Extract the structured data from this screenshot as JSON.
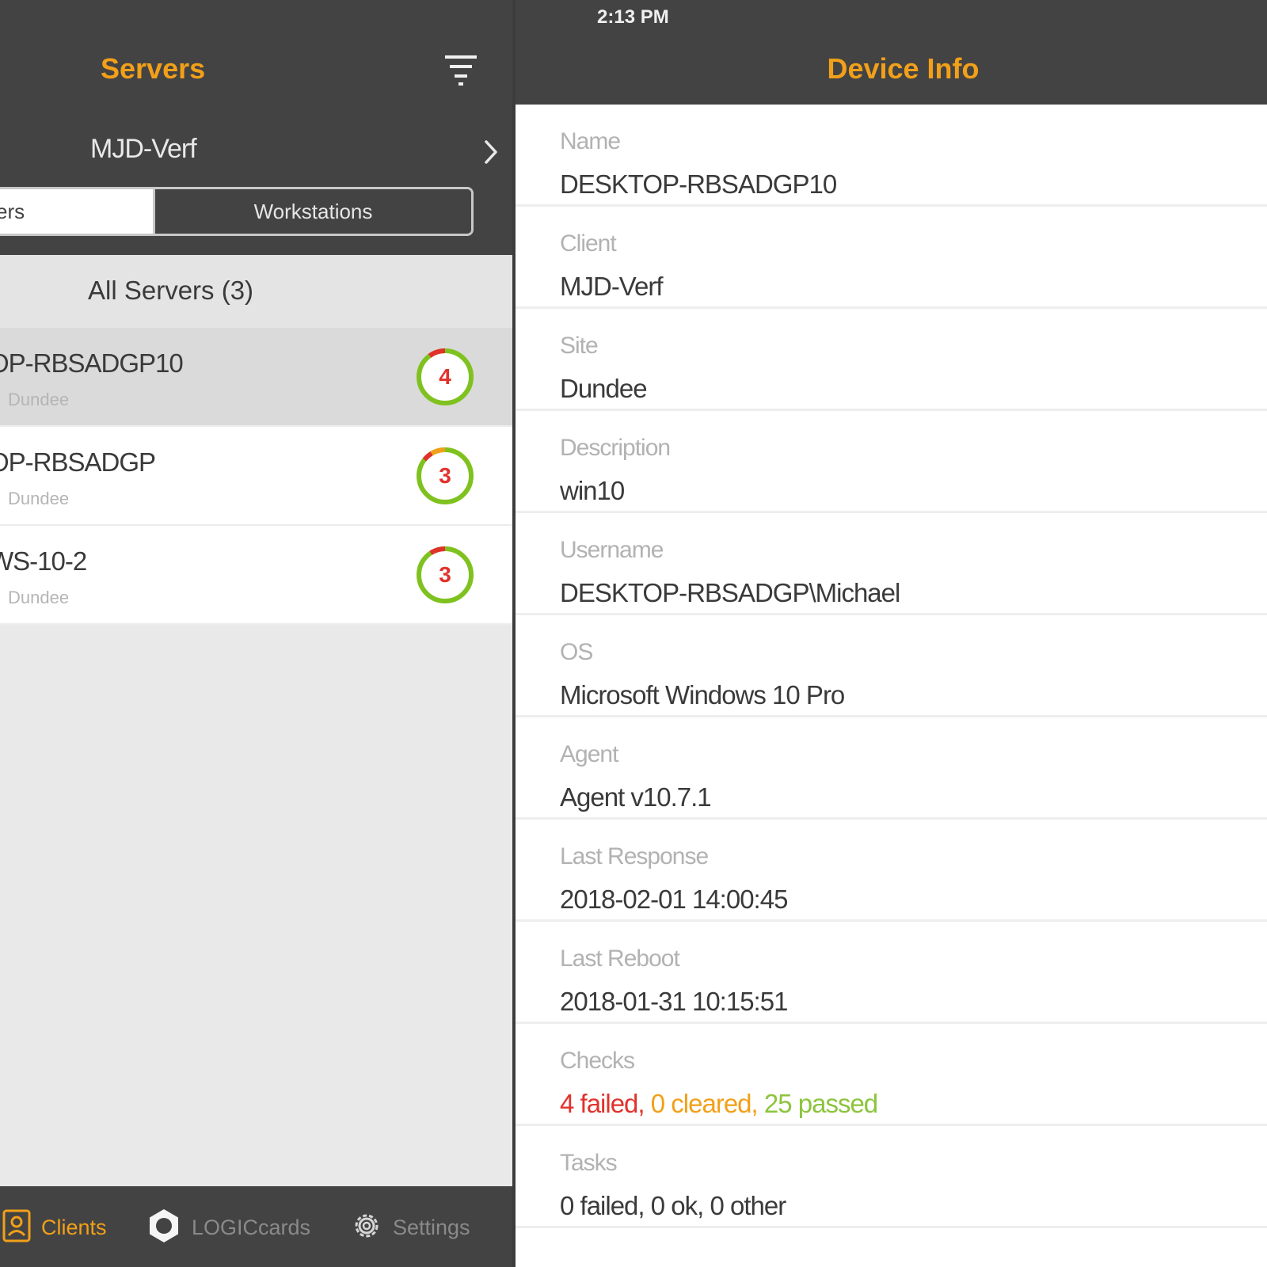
{
  "status_bar": {
    "time": "2:13 PM"
  },
  "left": {
    "title": "Servers",
    "client": "MJD-Verf",
    "segments": [
      "ers",
      "Workstations"
    ],
    "group_title": "All Servers  (3)",
    "devices": [
      {
        "name": "OP-RBSADGP10",
        "site": "Dundee",
        "count": "4",
        "selected": true
      },
      {
        "name": "OP-RBSADGP",
        "site": "Dundee",
        "count": "3",
        "selected": false
      },
      {
        "name": "WS-10-2",
        "site": "Dundee",
        "count": "3",
        "selected": false
      }
    ]
  },
  "tabbar": {
    "items": [
      {
        "label": "Clients",
        "icon": "clients-icon",
        "active": true
      },
      {
        "label": "LOGICcards",
        "icon": "logiccards-icon",
        "active": false
      },
      {
        "label": "Settings",
        "icon": "gear-icon",
        "active": false
      }
    ]
  },
  "right": {
    "title": "Device Info",
    "fields": [
      {
        "label": "Name",
        "value": "DESKTOP-RBSADGP10"
      },
      {
        "label": "Client",
        "value": "MJD-Verf"
      },
      {
        "label": "Site",
        "value": "Dundee"
      },
      {
        "label": "Description",
        "value": "win10"
      },
      {
        "label": "Username",
        "value": "DESKTOP-RBSADGP\\Michael"
      },
      {
        "label": "OS",
        "value": "Microsoft Windows 10 Pro"
      },
      {
        "label": "Agent",
        "value": "Agent v10.7.1"
      },
      {
        "label": "Last Response",
        "value": "2018-02-01 14:00:45"
      },
      {
        "label": "Last Reboot",
        "value": "2018-01-31 10:15:51"
      }
    ],
    "checks": {
      "label": "Checks",
      "failed": "4 failed",
      "cleared": "0 cleared",
      "passed": "25 passed",
      "separator": ", "
    },
    "tasks": {
      "label": "Tasks",
      "value": "0 failed, 0 ok, 0 other"
    }
  },
  "colors": {
    "accent": "#f2a019",
    "header_bg": "#434343",
    "failed": "#e0322b",
    "passed": "#8cc43c"
  }
}
